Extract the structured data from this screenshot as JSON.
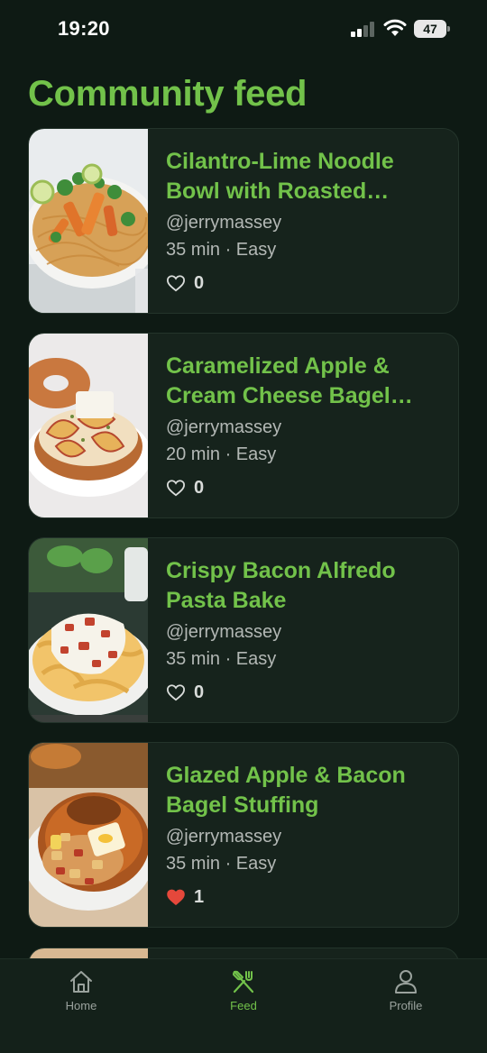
{
  "status_bar": {
    "time": "19:20",
    "battery": "47"
  },
  "page": {
    "title": "Community feed"
  },
  "feed": {
    "posts": [
      {
        "title": "Cilantro-Lime Noodle Bowl with Roasted Squash",
        "author": "@jerrymassey",
        "meta": "35 min · Easy",
        "likes": "0",
        "liked": false
      },
      {
        "title": "Caramelized Apple & Cream Cheese Bagel Toast",
        "author": "@jerrymassey",
        "meta": "20 min · Easy",
        "likes": "0",
        "liked": false
      },
      {
        "title": "Crispy Bacon Alfredo Pasta Bake",
        "author": "@jerrymassey",
        "meta": "35 min · Easy",
        "likes": "0",
        "liked": false
      },
      {
        "title": "Glazed Apple & Bacon Bagel Stuffing",
        "author": "@jerrymassey",
        "meta": "35 min · Easy",
        "likes": "1",
        "liked": true
      }
    ]
  },
  "tab_bar": {
    "items": [
      {
        "label": "Home",
        "icon": "home-icon",
        "active": false
      },
      {
        "label": "Feed",
        "icon": "utensils-icon",
        "active": true
      },
      {
        "label": "Profile",
        "icon": "person-icon",
        "active": false
      }
    ]
  },
  "colors": {
    "accent": "#72c24a",
    "background": "#0e1a14",
    "card": "#16231c",
    "liked": "#e5483b"
  }
}
